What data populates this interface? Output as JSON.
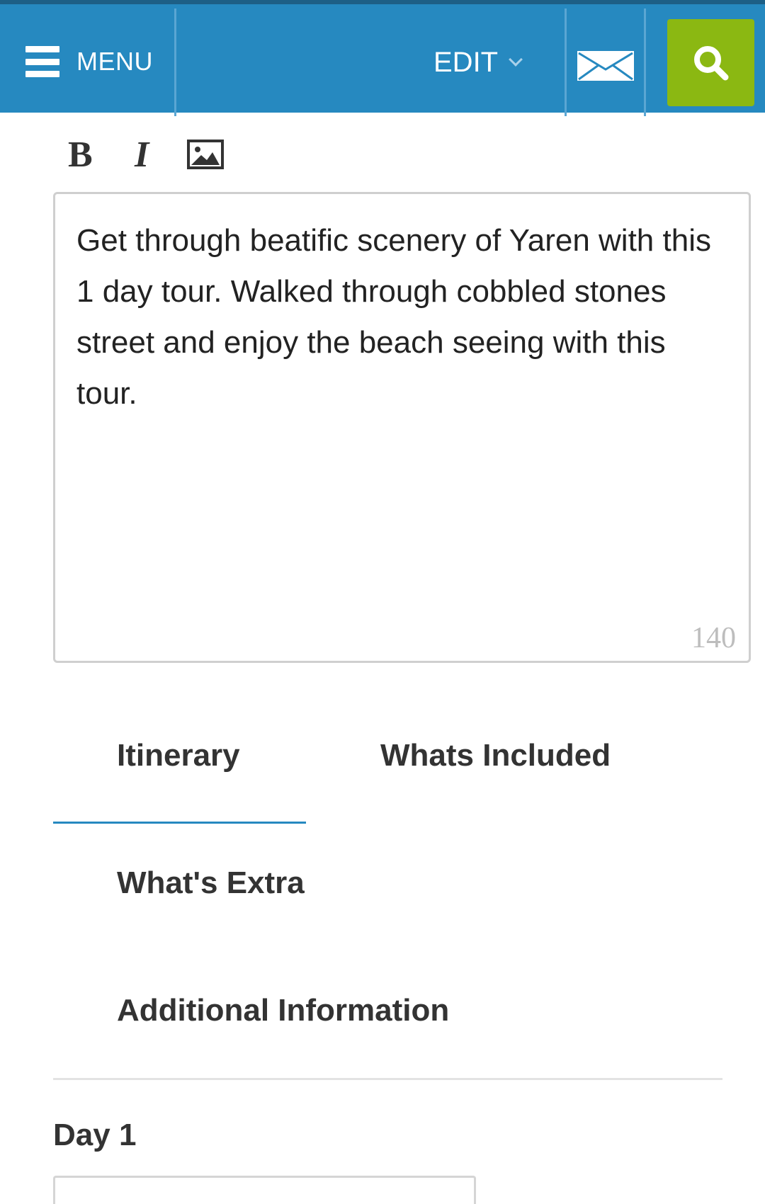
{
  "header": {
    "menu_label": "MENU",
    "edit_label": "EDIT",
    "icons": {
      "menu": "hamburger-icon",
      "edit_chevron": "chevron-down-icon",
      "mail": "envelope-icon",
      "search": "search-icon"
    },
    "colors": {
      "bar": "#2689c0",
      "search_button": "#8bb812"
    }
  },
  "toolbar": {
    "bold_label": "B",
    "italic_label": "I",
    "image_icon": "image-icon"
  },
  "editor": {
    "content": "Get through beatific scenery of Yaren with this 1 day tour. Walked through cobbled stones street and enjoy the beach seeing with this tour.",
    "char_count": "140"
  },
  "tabs": [
    {
      "label": "Itinerary",
      "active": true
    },
    {
      "label": "Whats Included",
      "active": false
    },
    {
      "label": "What's Extra",
      "active": false
    },
    {
      "label": "Additional Information",
      "active": false
    }
  ],
  "itinerary": {
    "day_title": "Day 1"
  }
}
